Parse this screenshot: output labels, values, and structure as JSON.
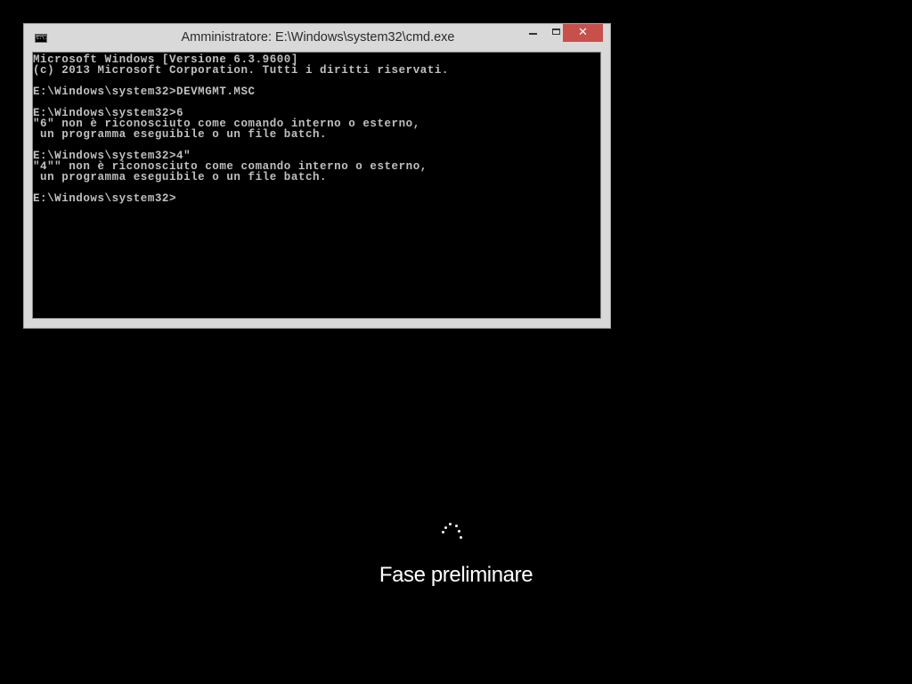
{
  "window": {
    "title": "Amministratore: E:\\Windows\\system32\\cmd.exe",
    "icon": "cmd-icon",
    "prompt_glyph": "C:\\.",
    "controls": {
      "minimize_icon": "minimize-icon",
      "maximize_icon": "maximize-icon",
      "close_icon": "close-icon",
      "close_glyph": "✕",
      "close_color": "#c7504b"
    }
  },
  "console": {
    "background": "#000000",
    "text_color": "#c0c0c0",
    "lines": [
      "Microsoft Windows [Versione 6.3.9600]",
      "(c) 2013 Microsoft Corporation. Tutti i diritti riservati.",
      "",
      "E:\\Windows\\system32>DEVMGMT.MSC",
      "",
      "E:\\Windows\\system32>6",
      "\"6\" non è riconosciuto come comando interno o esterno,",
      " un programma eseguibile o un file batch.",
      "",
      "E:\\Windows\\system32>4\"",
      "\"4\"\" non è riconosciuto come comando interno o esterno,",
      " un programma eseguibile o un file batch.",
      "",
      "E:\\Windows\\system32>"
    ]
  },
  "boot": {
    "spinner_icon": "loading-spinner-icon",
    "status_text": "Fase preliminare"
  }
}
